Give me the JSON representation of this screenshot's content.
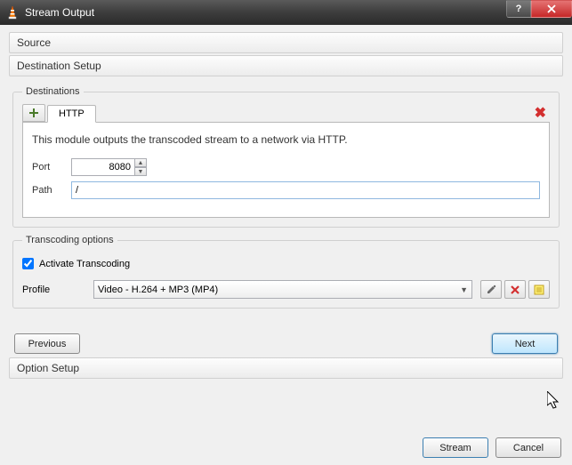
{
  "window": {
    "title": "Stream Output"
  },
  "sections": {
    "source": "Source",
    "destination_setup": "Destination Setup",
    "option_setup": "Option Setup"
  },
  "destinations": {
    "legend": "Destinations",
    "tab_http": "HTTP",
    "description": "This module outputs the transcoded stream to a network via HTTP.",
    "port_label": "Port",
    "port_value": "8080",
    "path_label": "Path",
    "path_value": "/"
  },
  "transcoding": {
    "legend": "Transcoding options",
    "activate_label": "Activate Transcoding",
    "activate_checked": true,
    "profile_label": "Profile",
    "profile_value": "Video - H.264 + MP3 (MP4)"
  },
  "nav": {
    "previous": "Previous",
    "next": "Next"
  },
  "footer": {
    "stream": "Stream",
    "cancel": "Cancel"
  }
}
